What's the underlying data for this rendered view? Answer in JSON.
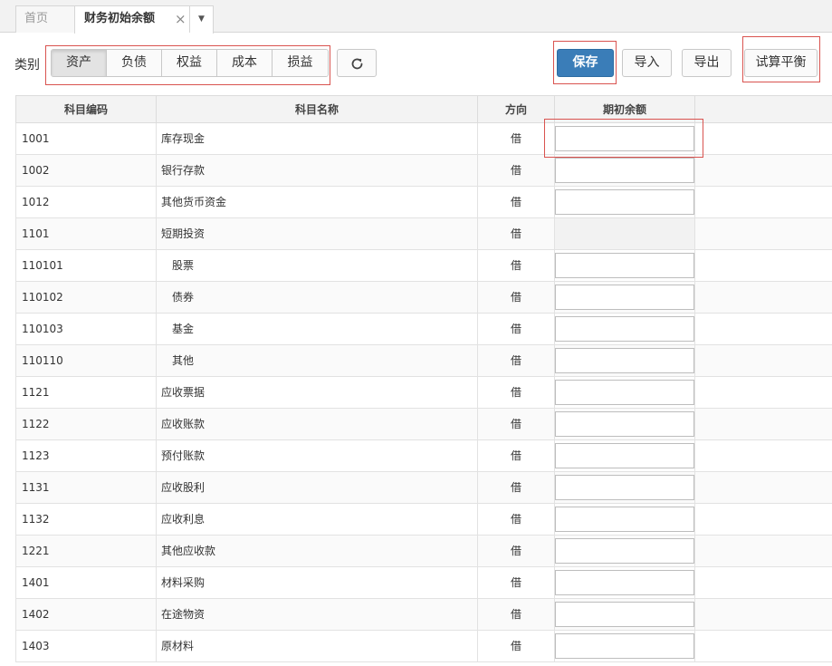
{
  "tabs": {
    "home_label": "首页",
    "active_label": "财务初始余额",
    "close_glyph": "×",
    "more_glyph": "▼"
  },
  "toolbar": {
    "category_label": "类别",
    "categories": [
      "资产",
      "负债",
      "权益",
      "成本",
      "损益"
    ],
    "active_category": "资产",
    "refresh_icon": "refresh-icon",
    "save_label": "保存",
    "import_label": "导入",
    "export_label": "导出",
    "trial_balance_label": "试算平衡"
  },
  "grid": {
    "headers": [
      "科目编码",
      "科目名称",
      "方向",
      "期初余额"
    ],
    "rows": [
      {
        "code": "1001",
        "name": "库存现金",
        "dir": "借",
        "indent": false,
        "editable": true,
        "value": ""
      },
      {
        "code": "1002",
        "name": "银行存款",
        "dir": "借",
        "indent": false,
        "editable": true,
        "value": ""
      },
      {
        "code": "1012",
        "name": "其他货币资金",
        "dir": "借",
        "indent": false,
        "editable": true,
        "value": ""
      },
      {
        "code": "1101",
        "name": "短期投资",
        "dir": "借",
        "indent": false,
        "editable": false,
        "value": ""
      },
      {
        "code": "110101",
        "name": "股票",
        "dir": "借",
        "indent": true,
        "editable": true,
        "value": ""
      },
      {
        "code": "110102",
        "name": "债券",
        "dir": "借",
        "indent": true,
        "editable": true,
        "value": ""
      },
      {
        "code": "110103",
        "name": "基金",
        "dir": "借",
        "indent": true,
        "editable": true,
        "value": ""
      },
      {
        "code": "110110",
        "name": "其他",
        "dir": "借",
        "indent": true,
        "editable": true,
        "value": ""
      },
      {
        "code": "1121",
        "name": "应收票据",
        "dir": "借",
        "indent": false,
        "editable": true,
        "value": ""
      },
      {
        "code": "1122",
        "name": "应收账款",
        "dir": "借",
        "indent": false,
        "editable": true,
        "value": ""
      },
      {
        "code": "1123",
        "name": "预付账款",
        "dir": "借",
        "indent": false,
        "editable": true,
        "value": ""
      },
      {
        "code": "1131",
        "name": "应收股利",
        "dir": "借",
        "indent": false,
        "editable": true,
        "value": ""
      },
      {
        "code": "1132",
        "name": "应收利息",
        "dir": "借",
        "indent": false,
        "editable": true,
        "value": ""
      },
      {
        "code": "1221",
        "name": "其他应收款",
        "dir": "借",
        "indent": false,
        "editable": true,
        "value": ""
      },
      {
        "code": "1401",
        "name": "材料采购",
        "dir": "借",
        "indent": false,
        "editable": true,
        "value": ""
      },
      {
        "code": "1402",
        "name": "在途物资",
        "dir": "借",
        "indent": false,
        "editable": true,
        "value": ""
      },
      {
        "code": "1403",
        "name": "原材料",
        "dir": "借",
        "indent": false,
        "editable": true,
        "value": ""
      }
    ]
  },
  "colors": {
    "highlight_box": "#d9534f",
    "save_button": "#3a7db8"
  }
}
